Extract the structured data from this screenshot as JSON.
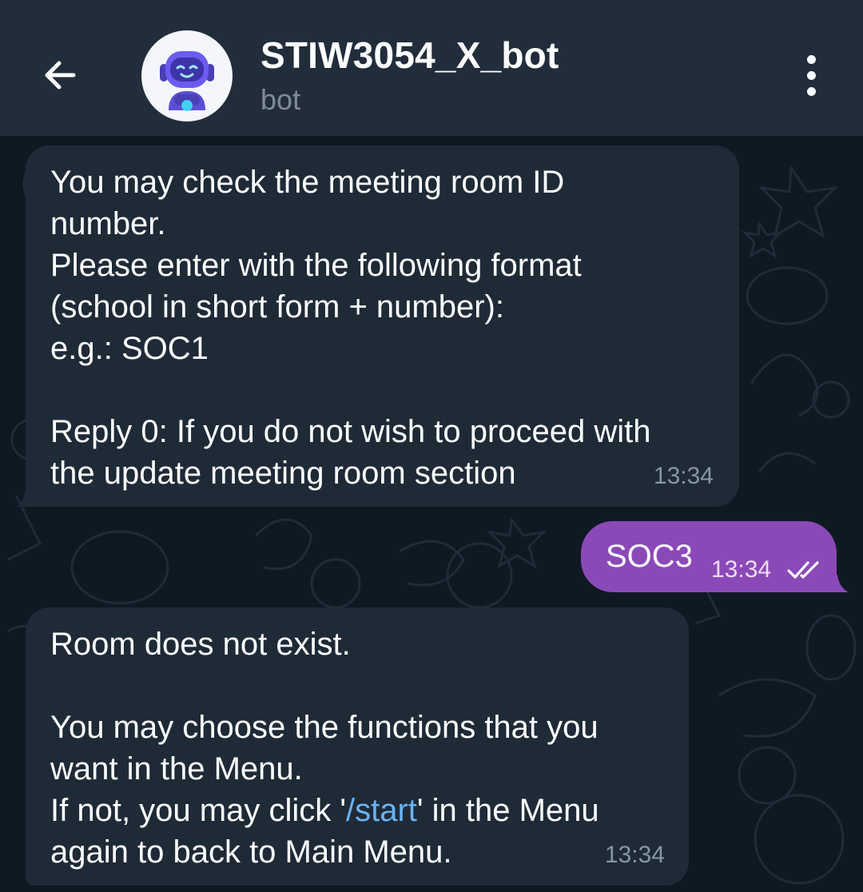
{
  "header": {
    "back_icon": "arrow-left-icon",
    "title": "STIW3054_X_bot",
    "subtitle": "bot",
    "avatar_icon": "robot-avatar-icon",
    "menu_icon": "more-vertical-icon"
  },
  "messages": [
    {
      "sender": "bot",
      "text": "You may check the meeting room ID\nnumber.\nPlease enter with the following format\n(school in short form + number):\ne.g.: SOC1\n\nReply 0: If you do not wish to proceed with\nthe update meeting room section",
      "time": "13:34"
    },
    {
      "sender": "me",
      "text": "SOC3",
      "time": "13:34",
      "status_icon": "double-check-icon"
    },
    {
      "sender": "bot",
      "text_before_link": "Room does not exist.\n\nYou may choose the functions that you\nwant in the Menu.\nIf not, you may click '",
      "link": "/start",
      "text_after_link": "' in the Menu\nagain to back to Main Menu.",
      "time": "13:34"
    }
  ],
  "colors": {
    "header_bg": "#212d3b",
    "chat_bg": "#0f1923",
    "incoming_bubble": "#1f2a37",
    "outgoing_bubble": "#8b49b8",
    "link": "#6ab3f3"
  }
}
